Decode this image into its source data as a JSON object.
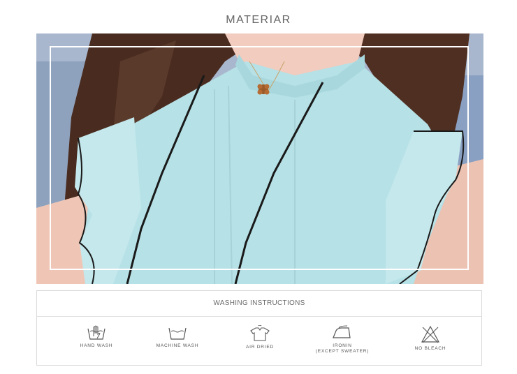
{
  "heading": "MATERIAR",
  "photo": {
    "subject": "light blue sleeveless chiffon blouse with black piping and ruffled sleeves"
  },
  "washing": {
    "title": "WASHING INSTRUCTIONS",
    "items": [
      {
        "icon": "hand-wash-icon",
        "label": "HAND WASH"
      },
      {
        "icon": "machine-wash-icon",
        "label": "MACHINE WASH"
      },
      {
        "icon": "air-dried-icon",
        "label": "AIR DRIED"
      },
      {
        "icon": "iron-icon",
        "label": "IRONIN\n(EXCEPT SWEATER)"
      },
      {
        "icon": "no-bleach-icon",
        "label": "NO BLEACH"
      }
    ]
  },
  "colors": {
    "blouse": "#b6e1e6",
    "piping": "#1a1a1a",
    "hair": "#4a2b1f",
    "background": "#9fb0c8",
    "icon_stroke": "#555555"
  }
}
